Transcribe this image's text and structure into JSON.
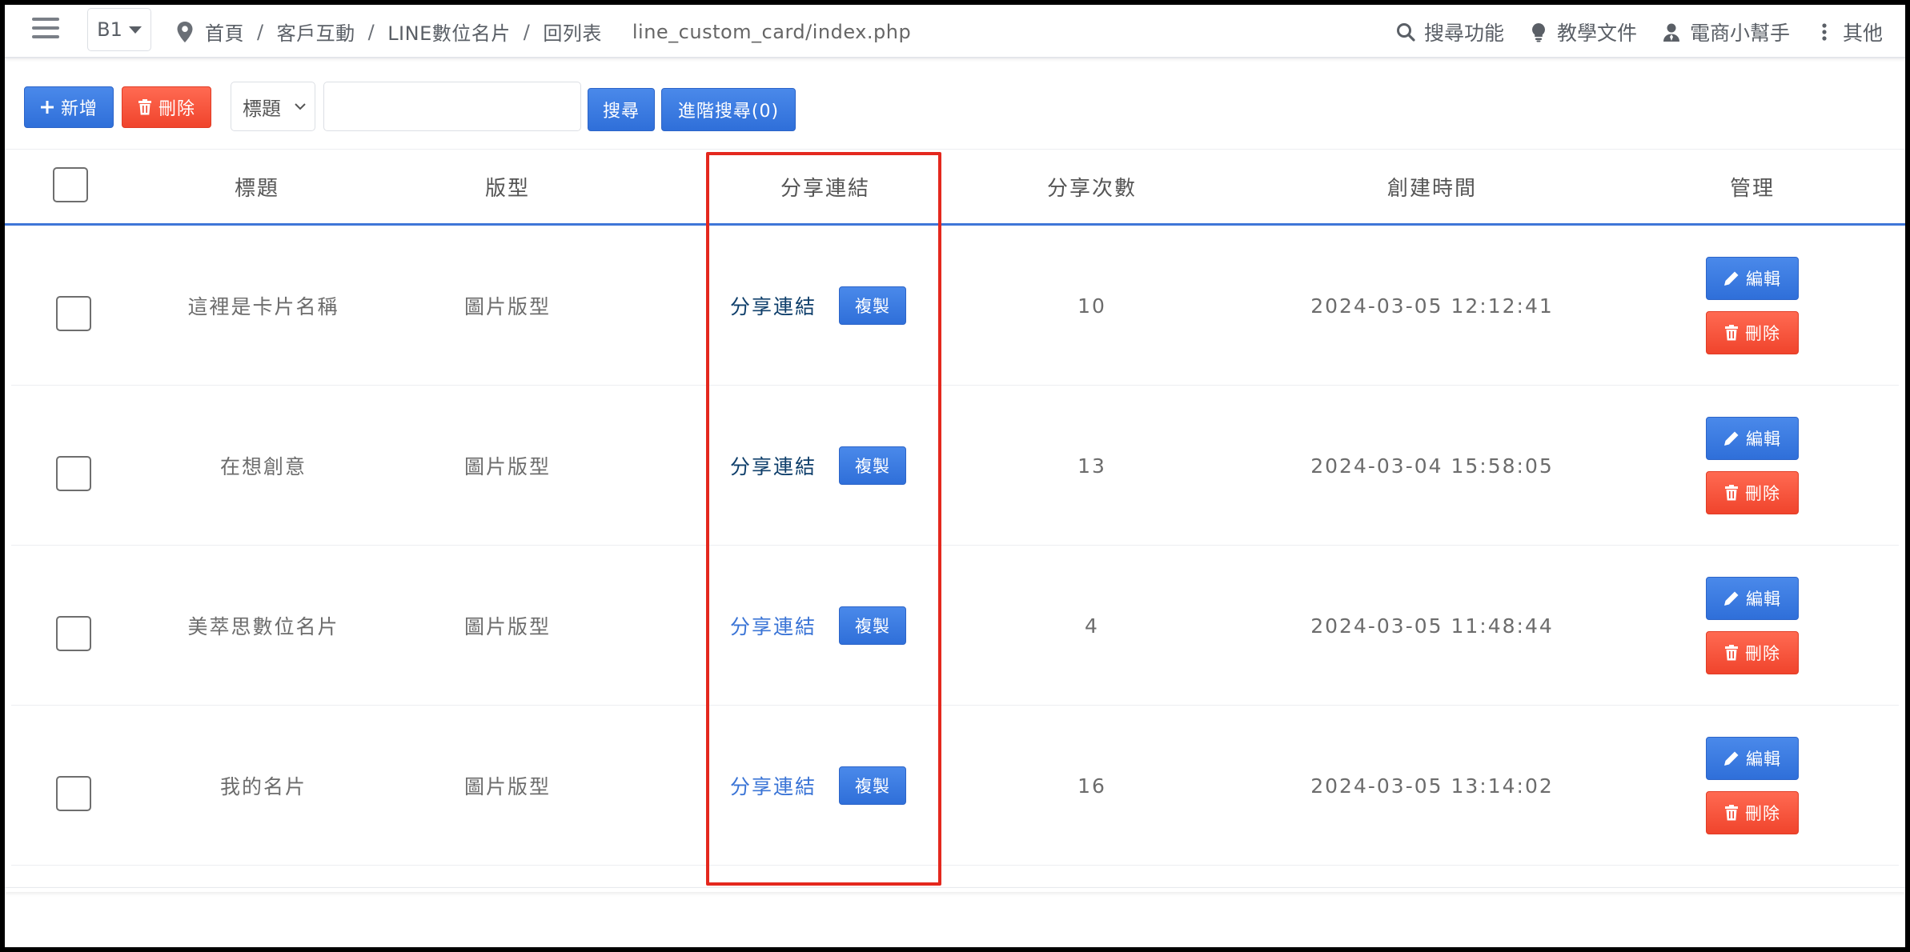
{
  "header": {
    "branch": "B1",
    "breadcrumb": [
      "首頁",
      "客戶互動",
      "LINE數位名片",
      "回列表"
    ],
    "path": "line_custom_card/index.php",
    "nav": [
      {
        "label": "搜尋功能",
        "icon": "search-icon"
      },
      {
        "label": "教學文件",
        "icon": "lightbulb-icon"
      },
      {
        "label": "電商小幫手",
        "icon": "user-icon"
      },
      {
        "label": "其他",
        "icon": "more-vertical-icon"
      }
    ]
  },
  "toolbar": {
    "add_label": "新增",
    "delete_label": "刪除",
    "search_field_selected": "標題",
    "search_value": "",
    "search_label": "搜尋",
    "advanced_label": "進階搜尋(0)"
  },
  "table": {
    "columns": [
      "標題",
      "版型",
      "分享連結",
      "分享次數",
      "創建時間",
      "管理"
    ],
    "rows": [
      {
        "title": "這裡是卡片名稱",
        "template": "圖片版型",
        "link": "分享連結",
        "copy": "複製",
        "count": "10",
        "created": "2024-03-05 12:12:41",
        "edit": "編輯",
        "delete": "刪除"
      },
      {
        "title": "在想創意",
        "template": "圖片版型",
        "link": "分享連結",
        "copy": "複製",
        "count": "13",
        "created": "2024-03-04 15:58:05",
        "edit": "編輯",
        "delete": "刪除"
      },
      {
        "title": "美萃思數位名片",
        "template": "圖片版型",
        "link": "分享連結",
        "copy": "複製",
        "count": "4",
        "created": "2024-03-05 11:48:44",
        "edit": "編輯",
        "delete": "刪除"
      },
      {
        "title": "我的名片",
        "template": "圖片版型",
        "link": "分享連結",
        "copy": "複製",
        "count": "16",
        "created": "2024-03-05 13:14:02",
        "edit": "編輯",
        "delete": "刪除"
      }
    ]
  },
  "colors": {
    "primary": "#3a78e0",
    "danger": "#f5533a",
    "highlight": "#e4281e",
    "link_visited": "#0f3f6b",
    "link": "#3a74d6"
  }
}
